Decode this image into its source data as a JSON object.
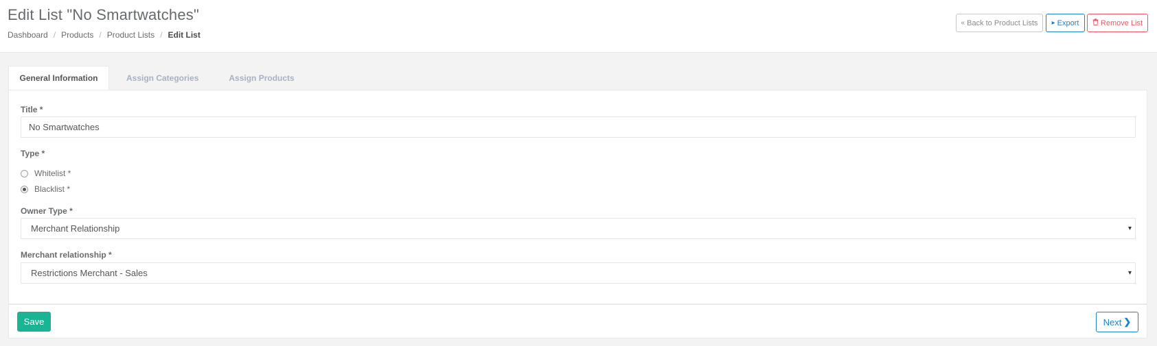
{
  "header": {
    "title": "Edit List \"No Smartwatches\"",
    "breadcrumb": [
      "Dashboard",
      "Products",
      "Product Lists",
      "Edit List"
    ],
    "buttons": {
      "back": "Back to Product Lists",
      "back_icon": "«",
      "export": "Export",
      "export_icon": "▸",
      "remove": "Remove List",
      "remove_icon": "🗑"
    }
  },
  "tabs": [
    "General Information",
    "Assign Categories",
    "Assign Products"
  ],
  "form": {
    "title_label": "Title *",
    "title_value": "No Smartwatches",
    "type_label": "Type *",
    "type_options": [
      "Whitelist *",
      "Blacklist *"
    ],
    "type_selected": "Blacklist *",
    "owner_type_label": "Owner Type *",
    "owner_type_value": "Merchant Relationship",
    "merchant_relationship_label": "Merchant relationship *",
    "merchant_relationship_value": "Restrictions Merchant - Sales",
    "caret": "▾"
  },
  "footer": {
    "save_label": "Save",
    "next_label": "Next",
    "next_icon": "❯"
  },
  "colors": {
    "primary": "#1ab394",
    "info": "#1c84c6",
    "danger": "#ed5565",
    "background": "#f3f3f4"
  }
}
